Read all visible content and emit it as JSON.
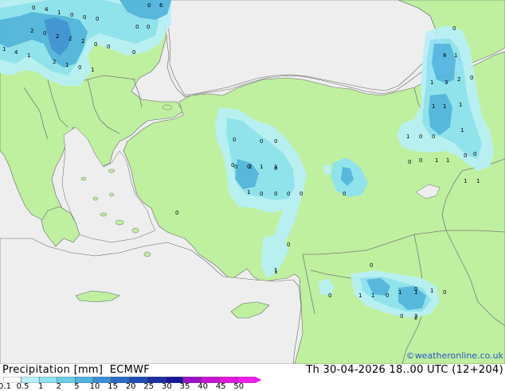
{
  "legend": {
    "title": "Precipitation [mm]",
    "model": "ECMWF",
    "datetime": "Th 30-04-2026 18..00 UTC (12+204)",
    "credit": "©weatheronline.co.uk",
    "ticks": [
      "0.1",
      "0.5",
      "1",
      "2",
      "5",
      "10",
      "15",
      "20",
      "25",
      "30",
      "35",
      "40",
      "45",
      "50"
    ],
    "colors": [
      "#ffffff",
      "#b8f0f8",
      "#8ee2f2",
      "#6ccde8",
      "#4fb4e0",
      "#3a8fd6",
      "#2a6cc8",
      "#1e4cb8",
      "#1a2fa0",
      "#16169a",
      "#9a12c8",
      "#c814d2",
      "#e018dc",
      "#f01cf0"
    ]
  },
  "map": {
    "colors": {
      "sea": "#eeeeee",
      "land": "#bff0a0",
      "border": "#7a7a7a",
      "coast": "#666666",
      "precip_light": "#b8f0f8",
      "precip_mid": "#8ee2f2",
      "precip_heavy": "#4fb4e0",
      "precip_max": "#3a8fd6"
    },
    "point_labels": [
      "0",
      "4",
      "1",
      "0",
      "0",
      "0",
      "0",
      "6",
      "2",
      "0",
      "2",
      "2",
      "2",
      "0",
      "0",
      "0",
      "0",
      "1",
      "4",
      "1",
      "2",
      "1",
      "0",
      "1",
      "0",
      "0",
      "0",
      "0",
      "0",
      "0",
      "1",
      "0",
      "2",
      "1",
      "0",
      "1",
      "0",
      "0",
      "0",
      "0",
      "0",
      "0",
      "0",
      "1",
      "1",
      "0",
      "0",
      "1",
      "1",
      "0",
      "2",
      "0",
      "8",
      "1",
      "3",
      "2",
      "0",
      "1",
      "1",
      "1",
      "1",
      "1",
      "0",
      "0",
      "1",
      "1",
      "0",
      "0",
      "1",
      "0",
      "0",
      "1",
      "1",
      "1",
      "1",
      "0",
      "0",
      "1",
      "0",
      "2"
    ]
  }
}
